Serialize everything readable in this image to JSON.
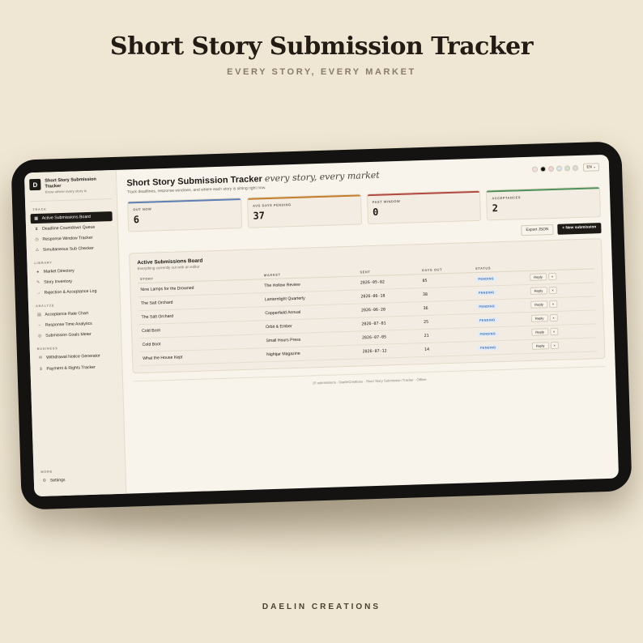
{
  "poster": {
    "title": "Short Story Submission Tracker",
    "tagline": "EVERY STORY, EVERY MARKET",
    "brand": "DAELIN CREATIONS"
  },
  "sidebar": {
    "logo_letter": "D",
    "app_name": "Short Story Submission Tracker",
    "app_sub": "Know where every story is",
    "sections": {
      "track": "TRACK",
      "library": "LIBRARY",
      "analyze": "ANALYZE",
      "business": "BUSINESS",
      "more": "MORE"
    },
    "track_items": [
      "Active Submissions Board",
      "Deadline Countdown Queue",
      "Response Window Tracker",
      "Simultaneous Sub Checker"
    ],
    "library_items": [
      "Market Directory",
      "Story Inventory",
      "Rejection & Acceptance Log"
    ],
    "analyze_items": [
      "Acceptance Rate Chart",
      "Response Time Analytics",
      "Submission Goals Meter"
    ],
    "business_items": [
      "Withdrawal Notice Generator",
      "Payment & Rights Tracker"
    ],
    "more_items": [
      "Settings"
    ]
  },
  "header": {
    "title": "Short Story Submission Tracker",
    "title_italic": "every story, every market",
    "description": "Track deadlines, response windows, and where each story is sitting right now.",
    "language": "EN",
    "swatch_colors": [
      "#f3dede",
      "#111111",
      "#f1d3cf",
      "#d8e7ee",
      "#cfe3d2",
      "#dcdcd4"
    ]
  },
  "stats": [
    {
      "label": "OUT NOW",
      "value": "6",
      "color": "#5b7fb4"
    },
    {
      "label": "AVG DAYS PENDING",
      "value": "37",
      "color": "#c47d2a"
    },
    {
      "label": "PAST WINDOW",
      "value": "0",
      "color": "#b3473d"
    },
    {
      "label": "ACCEPTANCES",
      "value": "2",
      "color": "#4f8f5b"
    }
  ],
  "actions": {
    "export": "Export JSON",
    "new": "+ New submission"
  },
  "board": {
    "title": "Active Submissions Board",
    "subtitle": "Everything currently out with an editor",
    "columns": [
      "STORY",
      "MARKET",
      "SENT",
      "DAYS OUT",
      "STATUS",
      ""
    ],
    "rows": [
      {
        "story": "Nine Lamps for the Drowned",
        "market": "The Hollow Review",
        "sent": "2026-05-02",
        "days": "85",
        "status": "PENDING"
      },
      {
        "story": "The Salt Orchard",
        "market": "Lanternlight Quarterly",
        "sent": "2026-06-18",
        "days": "38",
        "status": "PENDING"
      },
      {
        "story": "The Salt Orchard",
        "market": "Copperfield Annual",
        "sent": "2026-06-20",
        "days": "36",
        "status": "PENDING"
      },
      {
        "story": "Cold Boot",
        "market": "Orbit & Ember",
        "sent": "2026-07-01",
        "days": "25",
        "status": "PENDING"
      },
      {
        "story": "Cold Boot",
        "market": "Small Hours Press",
        "sent": "2026-07-05",
        "days": "21",
        "status": "PENDING"
      },
      {
        "story": "What the House Kept",
        "market": "Nightjar Magazine",
        "sent": "2026-07-12",
        "days": "14",
        "status": "PENDING"
      }
    ],
    "reply_label": "Reply",
    "remove_label": "×"
  },
  "footer": "15 submissions · DaelinCreations · Short Story Submission Tracker · Offline"
}
